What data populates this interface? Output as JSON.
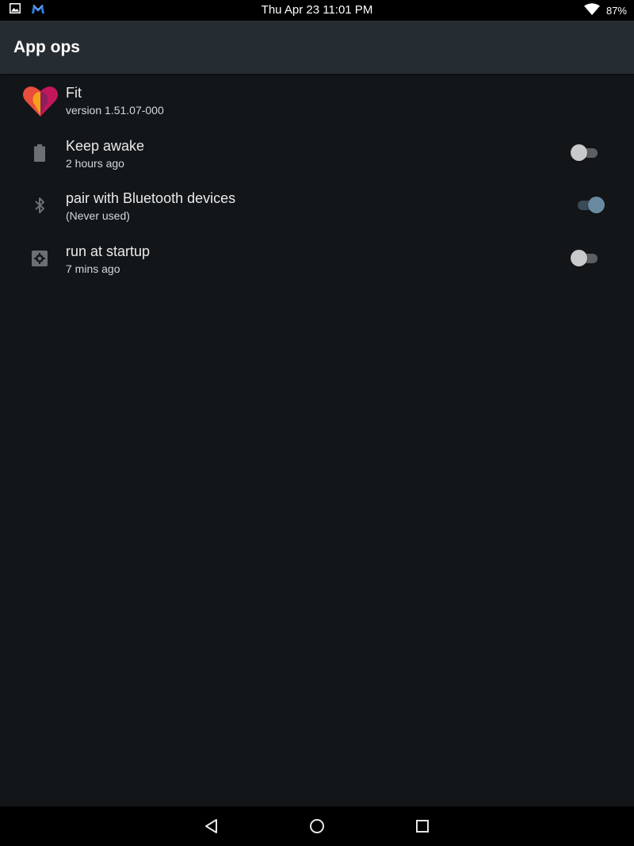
{
  "status_bar": {
    "time": "Thu Apr 23 11:01 PM",
    "battery": "87%",
    "icons": [
      "image-notification-icon",
      "malwarebytes-icon",
      "wifi-icon",
      "battery-icon"
    ]
  },
  "app_bar": {
    "title": "App ops"
  },
  "app": {
    "name": "Fit",
    "version": "version 1.51.07-000",
    "icon": "google-fit-heart-icon"
  },
  "ops": [
    {
      "label": "Keep awake",
      "detail": "2 hours ago",
      "icon": "battery-icon",
      "enabled": false
    },
    {
      "label": "pair with Bluetooth devices",
      "detail": "(Never used)",
      "icon": "bluetooth-icon",
      "enabled": true
    },
    {
      "label": "run at startup",
      "detail": "7 mins ago",
      "icon": "settings-chip-icon",
      "enabled": false
    }
  ],
  "nav_bar": {
    "icons": [
      "back-icon",
      "home-icon",
      "recents-icon"
    ]
  },
  "colors": {
    "background": "#131619",
    "app_bar": "#262d32",
    "switch_on": "#6a8aa0",
    "switch_off": "#c8c9ca"
  }
}
